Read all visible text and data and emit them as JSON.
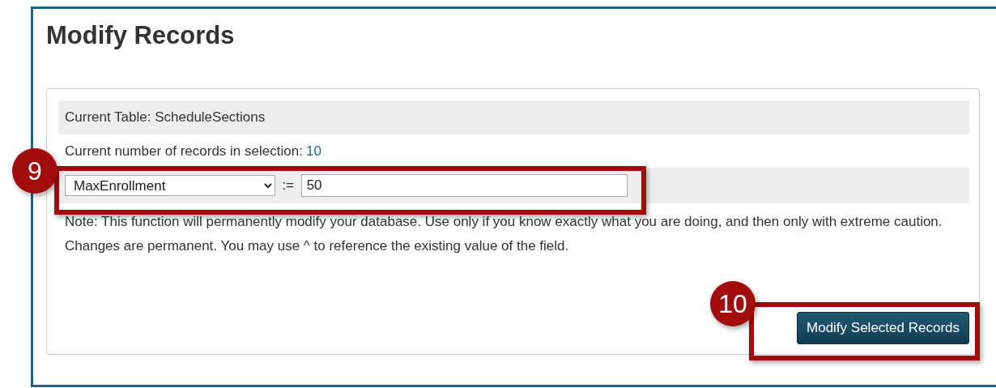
{
  "title": "Modify Records",
  "panel": {
    "current_table": "Current Table: ScheduleSections",
    "record_count_label": "Current number of records in selection:",
    "record_count": "10",
    "field_select": {
      "value": "MaxEnrollment"
    },
    "operator": ":=",
    "value_input": {
      "value": "50"
    },
    "note": "Note: This function will permanently modify your database. Use only if you know exactly what you are doing, and then only with extreme caution. Changes are permanent. You may use ^ to reference the existing value of the field.",
    "submit_button": "Modify Selected Records"
  },
  "callouts": [
    {
      "label": "9"
    },
    {
      "label": "10"
    }
  ]
}
